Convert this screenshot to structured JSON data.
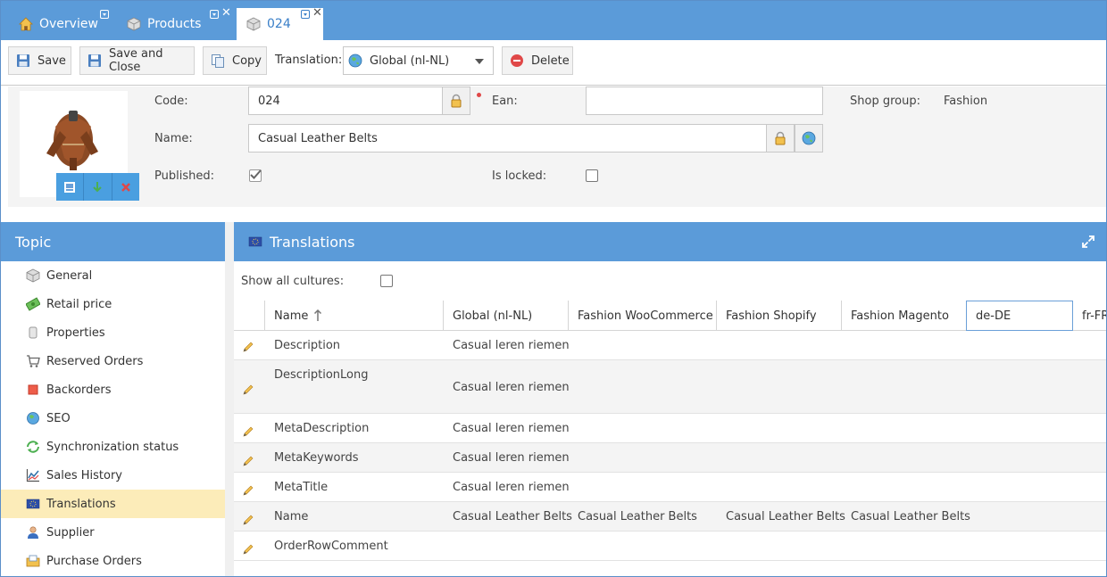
{
  "tabs": [
    {
      "label": "Overview"
    },
    {
      "label": "Products"
    },
    {
      "label": "024"
    }
  ],
  "toolbar": {
    "save": "Save",
    "save_close": "Save and Close",
    "copy": "Copy",
    "translation_label": "Translation:",
    "translation_value": "Global (nl-NL)",
    "delete": "Delete"
  },
  "form": {
    "code_label": "Code:",
    "code_value": "024",
    "ean_label": "Ean:",
    "ean_value": "",
    "shop_group_label": "Shop group:",
    "shop_group_value": "Fashion",
    "name_label": "Name:",
    "name_value": "Casual Leather Belts",
    "published_label": "Published:",
    "published_checked": true,
    "locked_label": "Is locked:",
    "locked_checked": false
  },
  "topic": {
    "title": "Topic",
    "items": [
      {
        "label": "General",
        "icon": "cube-icon"
      },
      {
        "label": "Retail price",
        "icon": "money-icon"
      },
      {
        "label": "Properties",
        "icon": "properties-icon"
      },
      {
        "label": "Reserved Orders",
        "icon": "cart-icon"
      },
      {
        "label": "Backorders",
        "icon": "backorder-icon"
      },
      {
        "label": "SEO",
        "icon": "globe-icon"
      },
      {
        "label": "Synchronization status",
        "icon": "sync-icon"
      },
      {
        "label": "Sales History",
        "icon": "chart-icon"
      },
      {
        "label": "Translations",
        "icon": "flag-eu-icon",
        "active": true
      },
      {
        "label": "Supplier",
        "icon": "person-icon"
      },
      {
        "label": "Purchase Orders",
        "icon": "purchase-icon"
      }
    ]
  },
  "translations": {
    "title": "Translations",
    "show_all_label": "Show all cultures:",
    "columns": [
      "Name",
      "Global (nl-NL)",
      "Fashion WooCommerce",
      "Fashion Shopify",
      "Fashion Magento",
      "de-DE",
      "fr-FR"
    ],
    "rows": [
      {
        "name": "Description",
        "global": "Casual leren riemen",
        "woo": "",
        "shopify": "",
        "magento": ""
      },
      {
        "name": "DescriptionLong",
        "global": "Casual leren riemen",
        "woo": "",
        "shopify": "",
        "magento": ""
      },
      {
        "name": "MetaDescription",
        "global": "Casual leren riemen",
        "woo": "",
        "shopify": "",
        "magento": ""
      },
      {
        "name": "MetaKeywords",
        "global": "Casual leren riemen",
        "woo": "",
        "shopify": "",
        "magento": ""
      },
      {
        "name": "MetaTitle",
        "global": "Casual leren riemen",
        "woo": "",
        "shopify": "",
        "magento": ""
      },
      {
        "name": "Name",
        "global": "Casual Leather Belts",
        "woo": "Casual Leather Belts",
        "shopify": "Casual Leather Belts",
        "magento": "Casual Leather Belts"
      },
      {
        "name": "OrderRowComment",
        "global": "",
        "woo": "",
        "shopify": "",
        "magento": ""
      }
    ]
  },
  "colors": {
    "header_blue": "#5b9bd9",
    "active_item": "#fcecb9",
    "tab_active_text": "#3a7fc8"
  }
}
